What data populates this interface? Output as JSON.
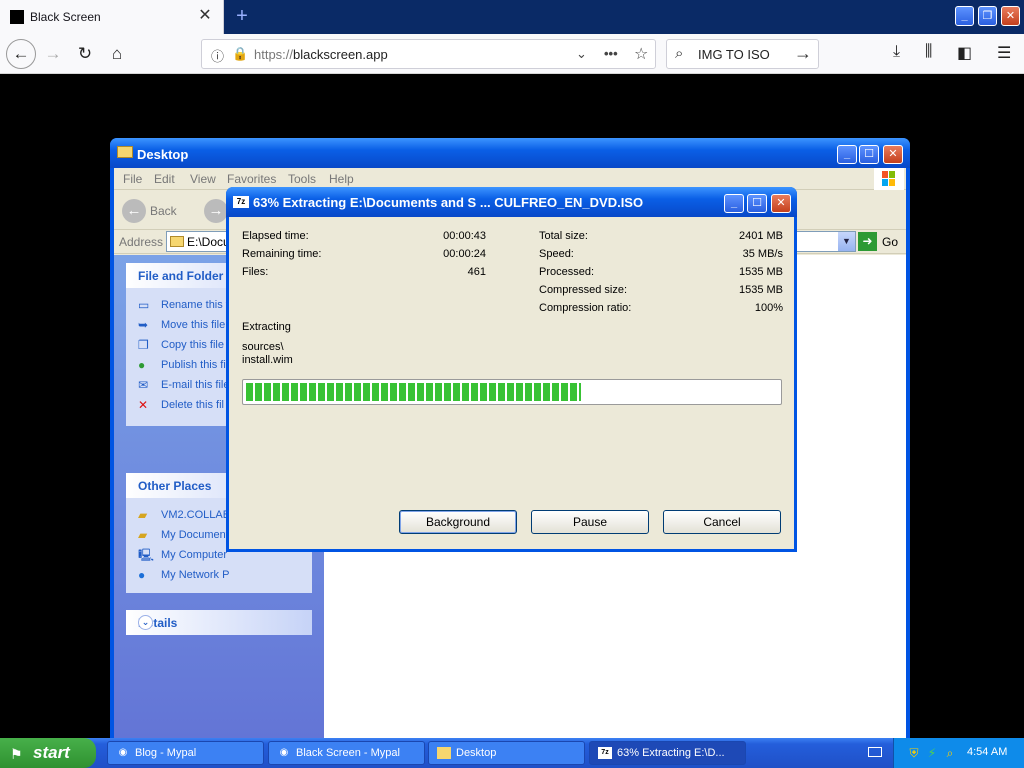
{
  "browser": {
    "tab_title": "Black Screen",
    "new_tab": "+",
    "url_scheme": "https://",
    "url_host": "blackscreen.app",
    "search_value": "IMG TO ISO"
  },
  "explorer": {
    "title": "Desktop",
    "menu": [
      "File",
      "Edit",
      "View",
      "Favorites",
      "Tools",
      "Help"
    ],
    "back_label": "Back",
    "address_label": "Address",
    "address_value": "E:\\Docu",
    "go_label": "Go",
    "file_folder_tasks": {
      "title": "File and Folder T",
      "items": [
        "Rename this f",
        "Move this file",
        "Copy this file",
        "Publish this fil",
        "E-mail this file",
        "Delete this fil"
      ]
    },
    "other_places": {
      "title": "Other Places",
      "items": [
        "VM2.COLLAB",
        "My Document",
        "My Computer",
        "My Network P"
      ]
    },
    "details_title": "Details"
  },
  "dialog": {
    "title": "63% Extracting E:\\Documents and S ... CULFREO_EN_DVD.ISO",
    "app_icon": "7z",
    "progress_percent": 63,
    "left_stats": [
      {
        "label": "Elapsed time:",
        "value": "00:00:43"
      },
      {
        "label": "Remaining time:",
        "value": "00:00:24"
      },
      {
        "label": "Files:",
        "value": "461"
      }
    ],
    "right_stats": [
      {
        "label": "Total size:",
        "value": "2401 MB"
      },
      {
        "label": "Speed:",
        "value": "35 MB/s"
      },
      {
        "label": "Processed:",
        "value": "1535 MB"
      },
      {
        "label": "Compressed size:",
        "value": "1535 MB"
      },
      {
        "label": "Compression ratio:",
        "value": "100%"
      }
    ],
    "status": "Extracting",
    "current_path": "sources\\",
    "current_file": "install.wim",
    "buttons": {
      "background": "Background",
      "pause": "Pause",
      "cancel": "Cancel"
    }
  },
  "taskbar": {
    "start_label": "start",
    "buttons": [
      {
        "label": "Blog - Mypal"
      },
      {
        "label": "Black Screen - Mypal"
      },
      {
        "label": "Desktop"
      },
      {
        "label": "63% Extracting E:\\D..."
      }
    ],
    "clock": "4:54 AM"
  },
  "colors": {
    "xp_blue": "#0054e3",
    "progress_green": "#38c234",
    "taskbar_blue": "#245edb",
    "start_green": "#2f9130"
  }
}
